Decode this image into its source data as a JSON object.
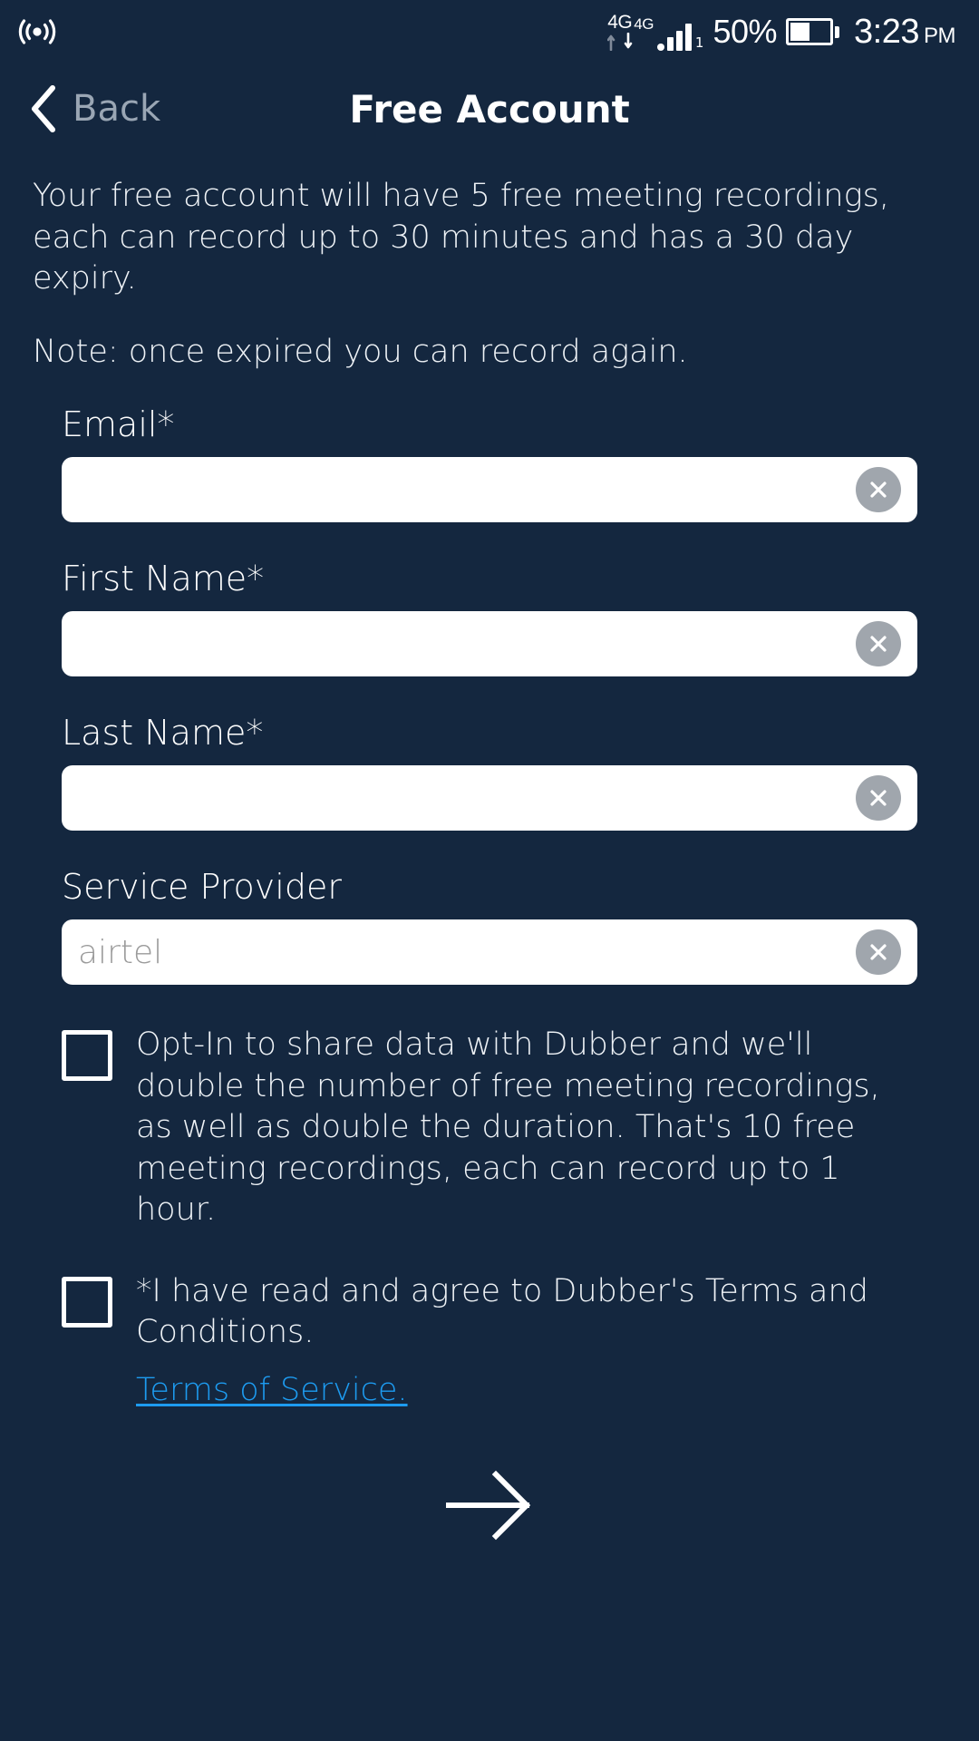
{
  "colors": {
    "background": "#14273f",
    "field_background": "#ffffff",
    "link": "#1d9bf0",
    "clear_button": "#a0a6ad",
    "back_label": "#9aa6b4",
    "placeholder": "#9b9b9b"
  },
  "status_bar": {
    "hotspot_icon": "broadcast-icon",
    "network_label_primary": "4G",
    "network_label_secondary": "4G",
    "signal_sub_label": "1",
    "battery_percent": "50%",
    "battery_level": 50,
    "time": "3:23",
    "time_period": "PM"
  },
  "nav": {
    "back_icon": "chevron-left-icon",
    "back_label": "Back",
    "title": "Free Account"
  },
  "intro": {
    "paragraph": "Your free account will have 5 free meeting recordings, each can record up to 30 minutes and has a 30 day expiry.",
    "note": "Note: once expired you can record again."
  },
  "form": {
    "fields": [
      {
        "label": "Email*",
        "value": "",
        "placeholder": "",
        "clear_icon": "close-circle-icon"
      },
      {
        "label": "First Name*",
        "value": "",
        "placeholder": "",
        "clear_icon": "close-circle-icon"
      },
      {
        "label": "Last Name*",
        "value": "",
        "placeholder": "",
        "clear_icon": "close-circle-icon"
      },
      {
        "label": "Service Provider",
        "value": "airtel",
        "placeholder": "airtel",
        "clear_icon": "close-circle-icon"
      }
    ]
  },
  "checkboxes": {
    "opt_in": {
      "checked": false,
      "text": "Opt-In to share data with Dubber and we'll double the number of free meeting recordings, as well as double the duration. That's 10 free meeting recordings, each can record up to 1 hour."
    },
    "terms": {
      "checked": false,
      "text": "*I have read and agree to Dubber's Terms and Conditions.",
      "link_label": "Terms of Service."
    }
  },
  "next": {
    "icon": "arrow-right-icon"
  }
}
